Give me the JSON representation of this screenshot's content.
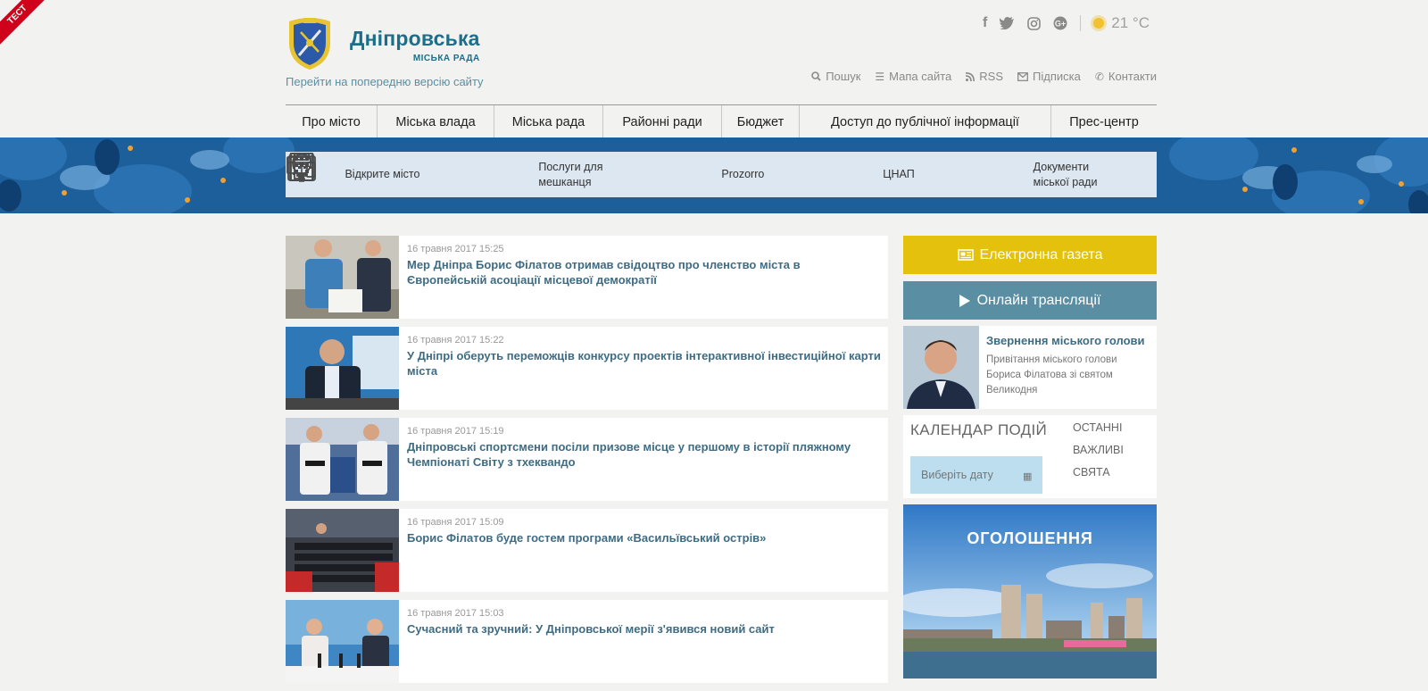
{
  "ribbon": "ТЕСТ",
  "logo": {
    "title": "Дніпровська",
    "subtitle": "МІСЬКА РАДА"
  },
  "prev_version_link": "Перейти на попередню версію сайту",
  "weather": {
    "temp": "21 °C",
    "icon": "sun-icon"
  },
  "social": [
    "facebook-icon",
    "twitter-icon",
    "instagram-icon",
    "googleplus-icon"
  ],
  "utility": {
    "search": "Пошук",
    "sitemap": "Мапа сайта",
    "rss": "RSS",
    "subscribe": "Підписка",
    "contacts": "Контакти"
  },
  "menu": [
    "Про місто",
    "Міська влада",
    "Міська рада",
    "Районні ради",
    "Бюджет",
    "Доступ до публічної інформації",
    "Прес-центр"
  ],
  "quick_links": [
    {
      "label": "Відкрите місто",
      "icon": "monitor-icon"
    },
    {
      "label_1": "Послуги для",
      "label_2": "мешканця",
      "icon": "building-icon"
    },
    {
      "label": "Prozorro",
      "icon": "calendar-icon"
    },
    {
      "label": "ЦНАП",
      "icon": "lightbulb-icon"
    },
    {
      "label_1": "Документи",
      "label_2": "міської ради",
      "icon": "book-icon"
    }
  ],
  "news": [
    {
      "date": "16 травня 2017 15:25",
      "title": "Мер Дніпра Борис Філатов отримав свідоцтво про членство міста в Європейській асоціації місцевої демократії"
    },
    {
      "date": "16 травня 2017 15:22",
      "title": "У Дніпрі оберуть переможців конкурсу проектів інтерактивної інвестиційної карти міста"
    },
    {
      "date": "16 травня 2017 15:19",
      "title": "Дніпровські спортсмени посіли призове місце у першому в історії пляжному Чемпіонаті Світу з тхеквандо"
    },
    {
      "date": "16 травня 2017 15:09",
      "title": "Борис Філатов буде гостем програми «Васильївський острів»"
    },
    {
      "date": "16 травня 2017 15:03",
      "title": "Сучасний та зручний: У Дніпровської мерії з'явився новий сайт"
    }
  ],
  "sidebar": {
    "gazeta": "Електронна газета",
    "online": "Онлайн трансляції",
    "address": {
      "title": "Звернення міського голови",
      "text": "Привітання міського голови Бориса Філатова зі святом Великодня"
    },
    "calendar": {
      "title": "КАЛЕНДАР ПОДІЙ",
      "placeholder": "Виберіть дату",
      "tabs": [
        "ОСТАННІ",
        "ВАЖЛИВІ",
        "СВЯТА"
      ]
    },
    "announce": "ОГОЛОШЕННЯ"
  },
  "colors": {
    "brand": "#1a6f8a",
    "news_title": "#3f6c82",
    "gazeta_button": "#e4c10c",
    "online_button": "#5a8ea3",
    "band": "#1d5f9a"
  }
}
